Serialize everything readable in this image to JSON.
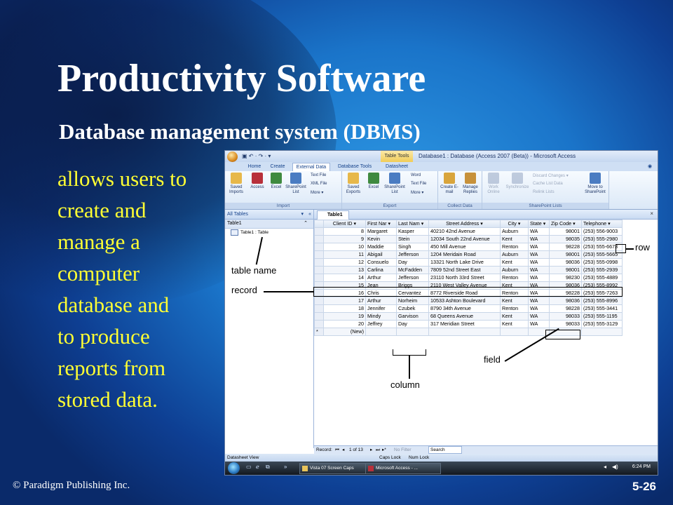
{
  "slide": {
    "title": "Productivity Software",
    "subtitle": "Database management system (DBMS)",
    "body_lines": [
      "allows users to",
      "create and",
      "manage a",
      "computer",
      "database and",
      "to produce",
      "reports from",
      "stored data."
    ],
    "copyright": "© Paradigm Publishing Inc.",
    "page_number": "5-26"
  },
  "window": {
    "title": "Database1 : Database (Access 2007 (Beta)) - Microsoft Access",
    "context_tab_group": "Table Tools",
    "qat": "▣ ↶ · ↷ · ▾"
  },
  "ribbon_tabs": [
    "Home",
    "Create",
    "External Data",
    "Database Tools",
    "Datasheet"
  ],
  "ribbon": {
    "import_group": "Import",
    "import_buttons": [
      "Saved Imports",
      "Access",
      "Excel",
      "SharePoint List"
    ],
    "import_small": [
      "Text File",
      "XML File",
      "More ▾"
    ],
    "export_group": "Export",
    "export_buttons": [
      "Saved Exports",
      "Excel",
      "SharePoint List"
    ],
    "export_small": [
      "Word",
      "Text File",
      "More ▾"
    ],
    "collect_group": "Collect Data",
    "collect_buttons": [
      "Create E-mail",
      "Manage Replies"
    ],
    "sharepoint_group": "SharePoint Lists",
    "sharepoint_buttons": [
      "Work Online",
      "Synchronize"
    ],
    "sharepoint_small": [
      "Discard Changes ▾",
      "Cache List Data",
      "Relink Lists"
    ],
    "move_button": "Move to SharePoint"
  },
  "nav_pane": {
    "header": "All Tables",
    "group": "Table1",
    "item": "Table1 : Table"
  },
  "document_tab": "Table1",
  "columns": [
    "Client ID ▾",
    "First Nar ▾",
    "Last Nam ▾",
    "Street Address ▾",
    "City ▾",
    "State ▾",
    "Zip Code ▾",
    "Telephone ▾"
  ],
  "rows": [
    [
      "8",
      "Margaret",
      "Kasper",
      "40210 42nd Avenue",
      "Auburn",
      "WA",
      "98001",
      "(253) 556-9003"
    ],
    [
      "9",
      "Kevin",
      "Stein",
      "12034 South 22nd Avenue",
      "Kent",
      "WA",
      "98035",
      "(253) 555-2980"
    ],
    [
      "10",
      "Maddie",
      "Singh",
      "450 Mill Avenue",
      "Renton",
      "WA",
      "98228",
      "(253) 555-6673"
    ],
    [
      "11",
      "Abigail",
      "Jefferson",
      "1204 Meridain Road",
      "Auburn",
      "WA",
      "98001",
      "(253) 555-5665"
    ],
    [
      "12",
      "Consuelo",
      "Day",
      "13321 North Lake Drive",
      "Kent",
      "WA",
      "98036",
      "(253) 555-0998"
    ],
    [
      "13",
      "Carlina",
      "McFadden",
      "7809 52nd Street East",
      "Auburn",
      "WA",
      "98001",
      "(253) 555-2939"
    ],
    [
      "14",
      "Arthur",
      "Jefferson",
      "23110 North 33rd Street",
      "Renton",
      "WA",
      "98230",
      "(253) 555-4889"
    ],
    [
      "15",
      "Jean",
      "Briggs",
      "2110 West Valley Avenue",
      "Kent",
      "WA",
      "98036",
      "(253) 555-8992"
    ],
    [
      "16",
      "Chris",
      "Cervantez",
      "8772 Riverside Road",
      "Renton",
      "WA",
      "98228",
      "(253) 555-7263"
    ],
    [
      "17",
      "Arthur",
      "Norheim",
      "10533 Ashton Boulevard",
      "Kent",
      "WA",
      "98036",
      "(253) 555-8996"
    ],
    [
      "18",
      "Jennifer",
      "Czubek",
      "8790 34th Avenue",
      "Renton",
      "WA",
      "98228",
      "(253) 555-3441"
    ],
    [
      "19",
      "Mindy",
      "Garvison",
      "68 Queens Avenue",
      "Kent",
      "WA",
      "98033",
      "(253) 555-1195"
    ],
    [
      "20",
      "Jeffrey",
      "Day",
      "317 Meridian Street",
      "Kent",
      "WA",
      "98033",
      "(253) 555-3129"
    ]
  ],
  "new_row": "(New)",
  "record_nav": {
    "label": "Record:",
    "position": "1 of 13",
    "filter": "No Filter",
    "search": "Search"
  },
  "status_bar": {
    "view": "Datasheet View",
    "caps": "Caps Lock",
    "num": "Num Lock"
  },
  "taskbar": {
    "items": [
      "Vista 07 Screen Caps",
      "Microsoft Access - ..."
    ],
    "clock": "6:24 PM"
  },
  "annotations": {
    "table_name": "table name",
    "record": "record",
    "row": "row",
    "field": "field",
    "column": "column"
  }
}
